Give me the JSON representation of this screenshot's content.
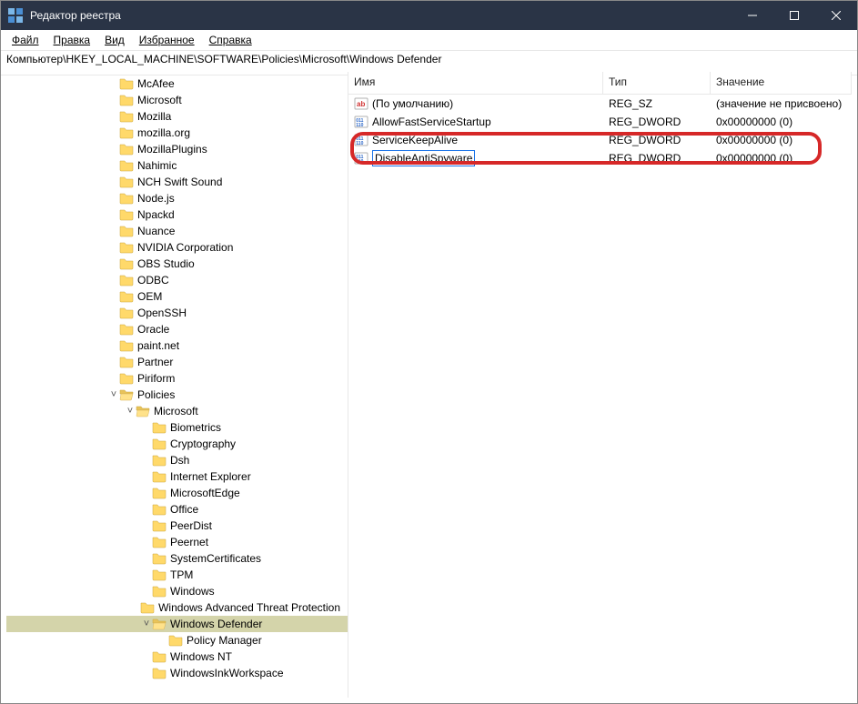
{
  "titlebar": {
    "title": "Редактор реестра"
  },
  "menu": {
    "file": "Файл",
    "edit": "Правка",
    "view": "Вид",
    "fav": "Избранное",
    "help": "Справка"
  },
  "address": "Компьютер\\HKEY_LOCAL_MACHINE\\SOFTWARE\\Policies\\Microsoft\\Windows Defender",
  "tree_items": [
    {
      "depth": 4,
      "exp": "",
      "label": "McAfee"
    },
    {
      "depth": 4,
      "exp": "",
      "label": "Microsoft"
    },
    {
      "depth": 4,
      "exp": "",
      "label": "Mozilla"
    },
    {
      "depth": 4,
      "exp": "",
      "label": "mozilla.org"
    },
    {
      "depth": 4,
      "exp": "",
      "label": "MozillaPlugins"
    },
    {
      "depth": 4,
      "exp": "",
      "label": "Nahimic"
    },
    {
      "depth": 4,
      "exp": "",
      "label": "NCH Swift Sound"
    },
    {
      "depth": 4,
      "exp": "",
      "label": "Node.js"
    },
    {
      "depth": 4,
      "exp": "",
      "label": "Npackd"
    },
    {
      "depth": 4,
      "exp": "",
      "label": "Nuance"
    },
    {
      "depth": 4,
      "exp": "",
      "label": "NVIDIA Corporation"
    },
    {
      "depth": 4,
      "exp": "",
      "label": "OBS Studio"
    },
    {
      "depth": 4,
      "exp": "",
      "label": "ODBC"
    },
    {
      "depth": 4,
      "exp": "",
      "label": "OEM"
    },
    {
      "depth": 4,
      "exp": "",
      "label": "OpenSSH"
    },
    {
      "depth": 4,
      "exp": "",
      "label": "Oracle"
    },
    {
      "depth": 4,
      "exp": "",
      "label": "paint.net"
    },
    {
      "depth": 4,
      "exp": "",
      "label": "Partner"
    },
    {
      "depth": 4,
      "exp": "",
      "label": "Piriform"
    },
    {
      "depth": 4,
      "exp": "v",
      "label": "Policies"
    },
    {
      "depth": 5,
      "exp": "v",
      "label": "Microsoft"
    },
    {
      "depth": 6,
      "exp": "",
      "label": "Biometrics"
    },
    {
      "depth": 6,
      "exp": "",
      "label": "Cryptography"
    },
    {
      "depth": 6,
      "exp": "",
      "label": "Dsh"
    },
    {
      "depth": 6,
      "exp": "",
      "label": "Internet Explorer"
    },
    {
      "depth": 6,
      "exp": "",
      "label": "MicrosoftEdge"
    },
    {
      "depth": 6,
      "exp": "",
      "label": "Office"
    },
    {
      "depth": 6,
      "exp": "",
      "label": "PeerDist"
    },
    {
      "depth": 6,
      "exp": "",
      "label": "Peernet"
    },
    {
      "depth": 6,
      "exp": "",
      "label": "SystemCertificates"
    },
    {
      "depth": 6,
      "exp": "",
      "label": "TPM"
    },
    {
      "depth": 6,
      "exp": "",
      "label": "Windows"
    },
    {
      "depth": 6,
      "exp": "",
      "label": "Windows Advanced Threat Protection"
    },
    {
      "depth": 6,
      "exp": "v",
      "label": "Windows Defender",
      "selected": true
    },
    {
      "depth": 7,
      "exp": "",
      "label": "Policy Manager"
    },
    {
      "depth": 6,
      "exp": "",
      "label": "Windows NT"
    },
    {
      "depth": 6,
      "exp": "",
      "label": "WindowsInkWorkspace"
    }
  ],
  "list": {
    "headers": {
      "name": "Имя",
      "type": "Тип",
      "data": "Значение"
    },
    "rows": [
      {
        "icon": "str",
        "name": "(По умолчанию)",
        "type": "REG_SZ",
        "data": "(значение не присвоено)"
      },
      {
        "icon": "bin",
        "name": "AllowFastServiceStartup",
        "type": "REG_DWORD",
        "data": "0x00000000 (0)"
      },
      {
        "icon": "bin",
        "name": "ServiceKeepAlive",
        "type": "REG_DWORD",
        "data": "0x00000000 (0)"
      },
      {
        "icon": "bin",
        "name": "DisableAntiSpyware",
        "type": "REG_DWORD",
        "data": "0x00000000 (0)",
        "editing": true
      }
    ]
  }
}
